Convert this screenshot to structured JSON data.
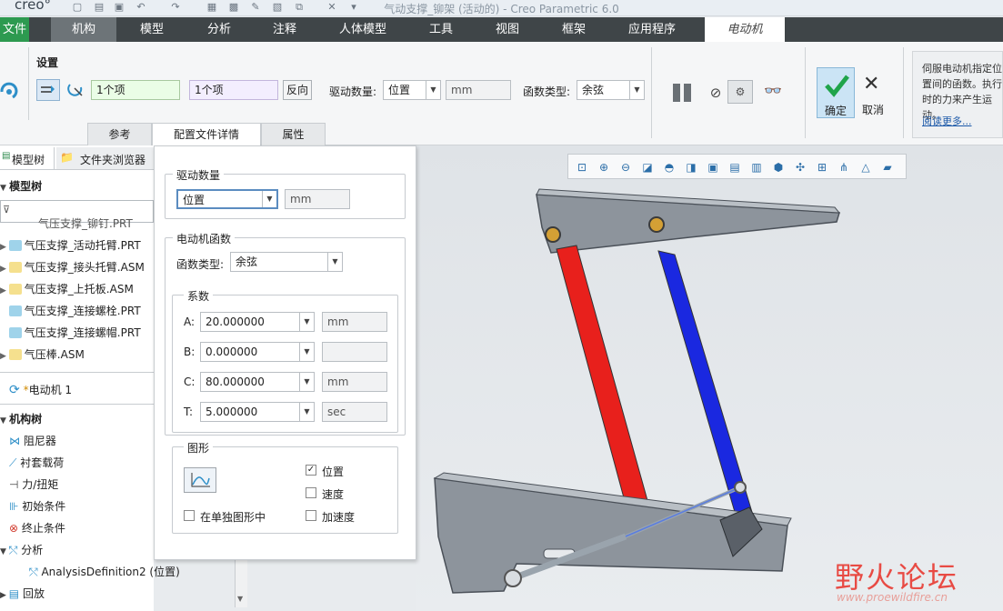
{
  "app": {
    "logo": "creo°",
    "window_title": "气动支撑_铆架 (活动的) - Creo Parametric 6.0"
  },
  "menu": {
    "tabs": [
      "文件",
      "机构",
      "模型",
      "分析",
      "注释",
      "人体模型",
      "工具",
      "视图",
      "框架",
      "应用程序",
      "电动机"
    ]
  },
  "ribbon": {
    "settings_label": "设置",
    "ref1": "1个项",
    "ref2": "1个项",
    "reverse_button": "反向",
    "drive_qty_label": "驱动数量:",
    "drive_qty_value": "位置",
    "drive_unit": "mm",
    "func_type_label": "函数类型:",
    "func_type_value": "余弦",
    "ok_label": "确定",
    "cancel_label": "取消",
    "help_text": "伺服电动机指定位置间的函数。执行时的力来产生运动。",
    "help_link": "阅读更多...",
    "subtabs": [
      "参考",
      "配置文件详情",
      "属性"
    ]
  },
  "panel": {
    "drive_qty_group": "驱动数量",
    "drive_qty_value": "位置",
    "drive_qty_unit": "mm",
    "motor_func_group": "电动机函数",
    "func_type_label": "函数类型:",
    "func_type_value": "余弦",
    "coeff_group": "系数",
    "coeffs": [
      {
        "label": "A:",
        "value": "20.000000",
        "unit": "mm"
      },
      {
        "label": "B:",
        "value": "0.000000",
        "unit": ""
      },
      {
        "label": "C:",
        "value": "80.000000",
        "unit": "mm"
      },
      {
        "label": "T:",
        "value": "5.000000",
        "unit": "sec"
      }
    ],
    "graph_group": "图形",
    "separate_graph_label": "在单独图形中",
    "checks": [
      {
        "label": "位置",
        "checked": true
      },
      {
        "label": "速度",
        "checked": false
      },
      {
        "label": "加速度",
        "checked": false
      }
    ]
  },
  "tree": {
    "tab_model": "模型树",
    "tab_folder": "文件夹浏览器",
    "model_tree_header": "模型树",
    "items": [
      "气压支撑_铆钉.PRT",
      "气压支撑_活动托臂.PRT",
      "气压支撑_接头托臂.ASM",
      "气压支撑_上托板.ASM",
      "气压支撑_连接螺栓.PRT",
      "气压支撑_连接螺帽.PRT",
      "气压棒.ASM"
    ],
    "motor_item": "电动机 1",
    "mech_tree_header": "机构树",
    "mech_items": [
      "阻尼器",
      "衬套载荷",
      "力/扭矩",
      "初始条件",
      "终止条件",
      "分析",
      "AnalysisDefinition2 (位置)",
      "回放"
    ]
  },
  "watermark": {
    "title": "野火论坛",
    "url": "www.proewildfire.cn"
  }
}
